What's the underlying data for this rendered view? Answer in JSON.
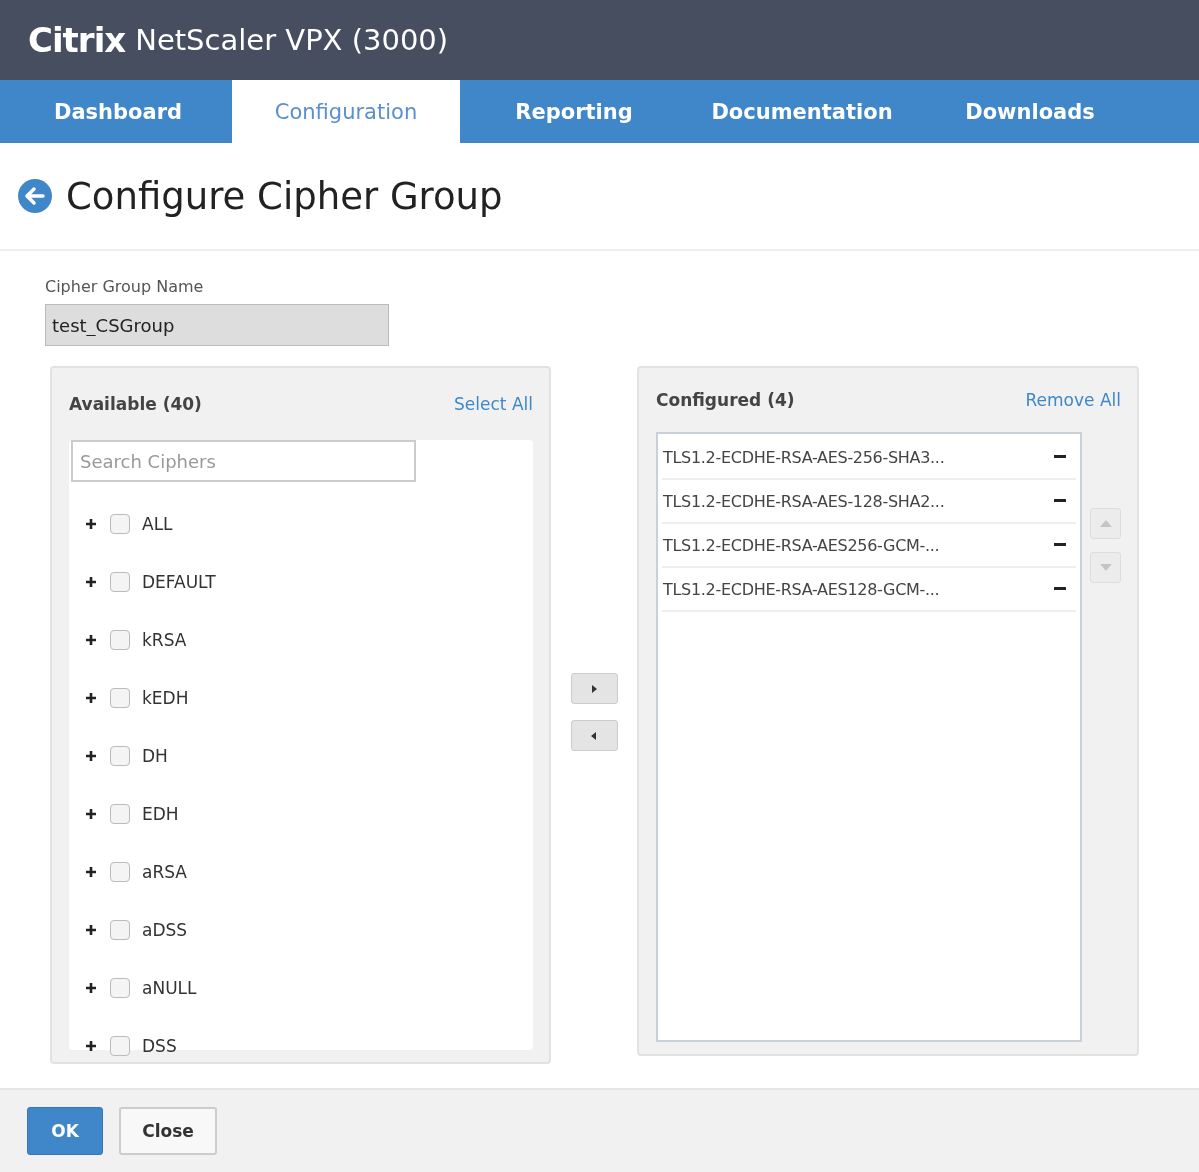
{
  "header": {
    "brand": "Citrix",
    "product": "NetScaler VPX (3000)"
  },
  "tabs": [
    {
      "label": "Dashboard",
      "selected": false
    },
    {
      "label": "Configuration",
      "selected": true
    },
    {
      "label": "Reporting",
      "selected": false
    },
    {
      "label": "Documentation",
      "selected": false
    },
    {
      "label": "Downloads",
      "selected": false
    }
  ],
  "page_title": "Configure Cipher Group",
  "name_field": {
    "label": "Cipher Group Name",
    "value": "test_CSGroup",
    "disabled": true
  },
  "available": {
    "title": "Available (40)",
    "action": "Select All",
    "search": {
      "placeholder": "Search Ciphers"
    },
    "items": [
      {
        "label": "ALL",
        "checked": false
      },
      {
        "label": "DEFAULT",
        "checked": false
      },
      {
        "label": "kRSA",
        "checked": false
      },
      {
        "label": "kEDH",
        "checked": false
      },
      {
        "label": "DH",
        "checked": false
      },
      {
        "label": "EDH",
        "checked": false
      },
      {
        "label": "aRSA",
        "checked": false
      },
      {
        "label": "aDSS",
        "checked": false
      },
      {
        "label": "aNULL",
        "checked": false
      },
      {
        "label": "DSS",
        "checked": false
      }
    ]
  },
  "configured": {
    "title": "Configured (4)",
    "action": "Remove All",
    "items": [
      "TLS1.2-ECDHE-RSA-AES-256-SHA3...",
      "TLS1.2-ECDHE-RSA-AES-128-SHA2...",
      "TLS1.2-ECDHE-RSA-AES256-GCM-...",
      "TLS1.2-ECDHE-RSA-AES128-GCM-..."
    ],
    "move_up_disabled": true,
    "move_down_disabled": true
  },
  "buttons": [
    {
      "label": "OK",
      "kind": "primary"
    },
    {
      "label": "Close",
      "kind": "secondary"
    }
  ]
}
